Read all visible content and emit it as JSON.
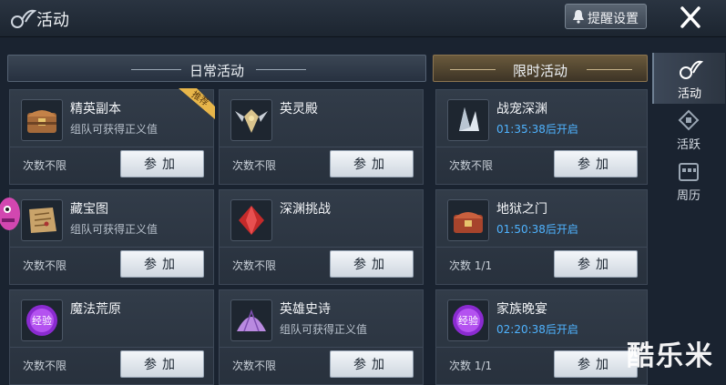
{
  "header": {
    "title": "活动",
    "remind_label": "提醒设置"
  },
  "sections": {
    "daily": "日常活动",
    "limited": "限时活动"
  },
  "daily_cards": [
    {
      "name": "精英副本",
      "desc": "组队可获得正义值",
      "count": "次数不限",
      "button": "参加",
      "icon": "treasure-chest-icon",
      "badge": "推荐"
    },
    {
      "name": "英灵殿",
      "desc": "",
      "count": "次数不限",
      "button": "参加",
      "icon": "winged-emblem-icon"
    },
    {
      "name": "藏宝图",
      "desc": "组队可获得正义值",
      "count": "次数不限",
      "button": "参加",
      "icon": "treasure-map-icon"
    },
    {
      "name": "深渊挑战",
      "desc": "",
      "count": "次数不限",
      "button": "参加",
      "icon": "red-crystal-icon"
    },
    {
      "name": "魔法荒原",
      "desc": "",
      "count": "次数不限",
      "button": "参加",
      "icon": "purple-orb-icon",
      "icon_text": "经验"
    },
    {
      "name": "英雄史诗",
      "desc": "组队可获得正义值",
      "count": "次数不限",
      "button": "参加",
      "icon": "purple-shell-icon"
    }
  ],
  "limited_cards": [
    {
      "name": "战宠深渊",
      "desc": "01:35:38后开启",
      "count": "次数不限",
      "button": "参加",
      "icon": "white-crystal-icon"
    },
    {
      "name": "地狱之门",
      "desc": "01:50:38后开启",
      "count": "次数 1/1",
      "button": "参加",
      "icon": "red-chest-icon"
    },
    {
      "name": "家族晚宴",
      "desc": "02:20:38后开启",
      "count": "次数 1/1",
      "button": "参加",
      "icon": "purple-orb-icon",
      "icon_text": "经验"
    }
  ],
  "side_tabs": [
    {
      "label": "活动",
      "icon": "activity-icon",
      "active": true
    },
    {
      "label": "活跃",
      "icon": "diamond-icon",
      "active": false
    },
    {
      "label": "周历",
      "icon": "calendar-icon",
      "active": false
    }
  ],
  "watermark": "酷乐米",
  "colors": {
    "background": "#1a2330",
    "timer": "#4fb3ff",
    "limited_header": "#6a5a3c",
    "button": "#e3e9ef"
  }
}
